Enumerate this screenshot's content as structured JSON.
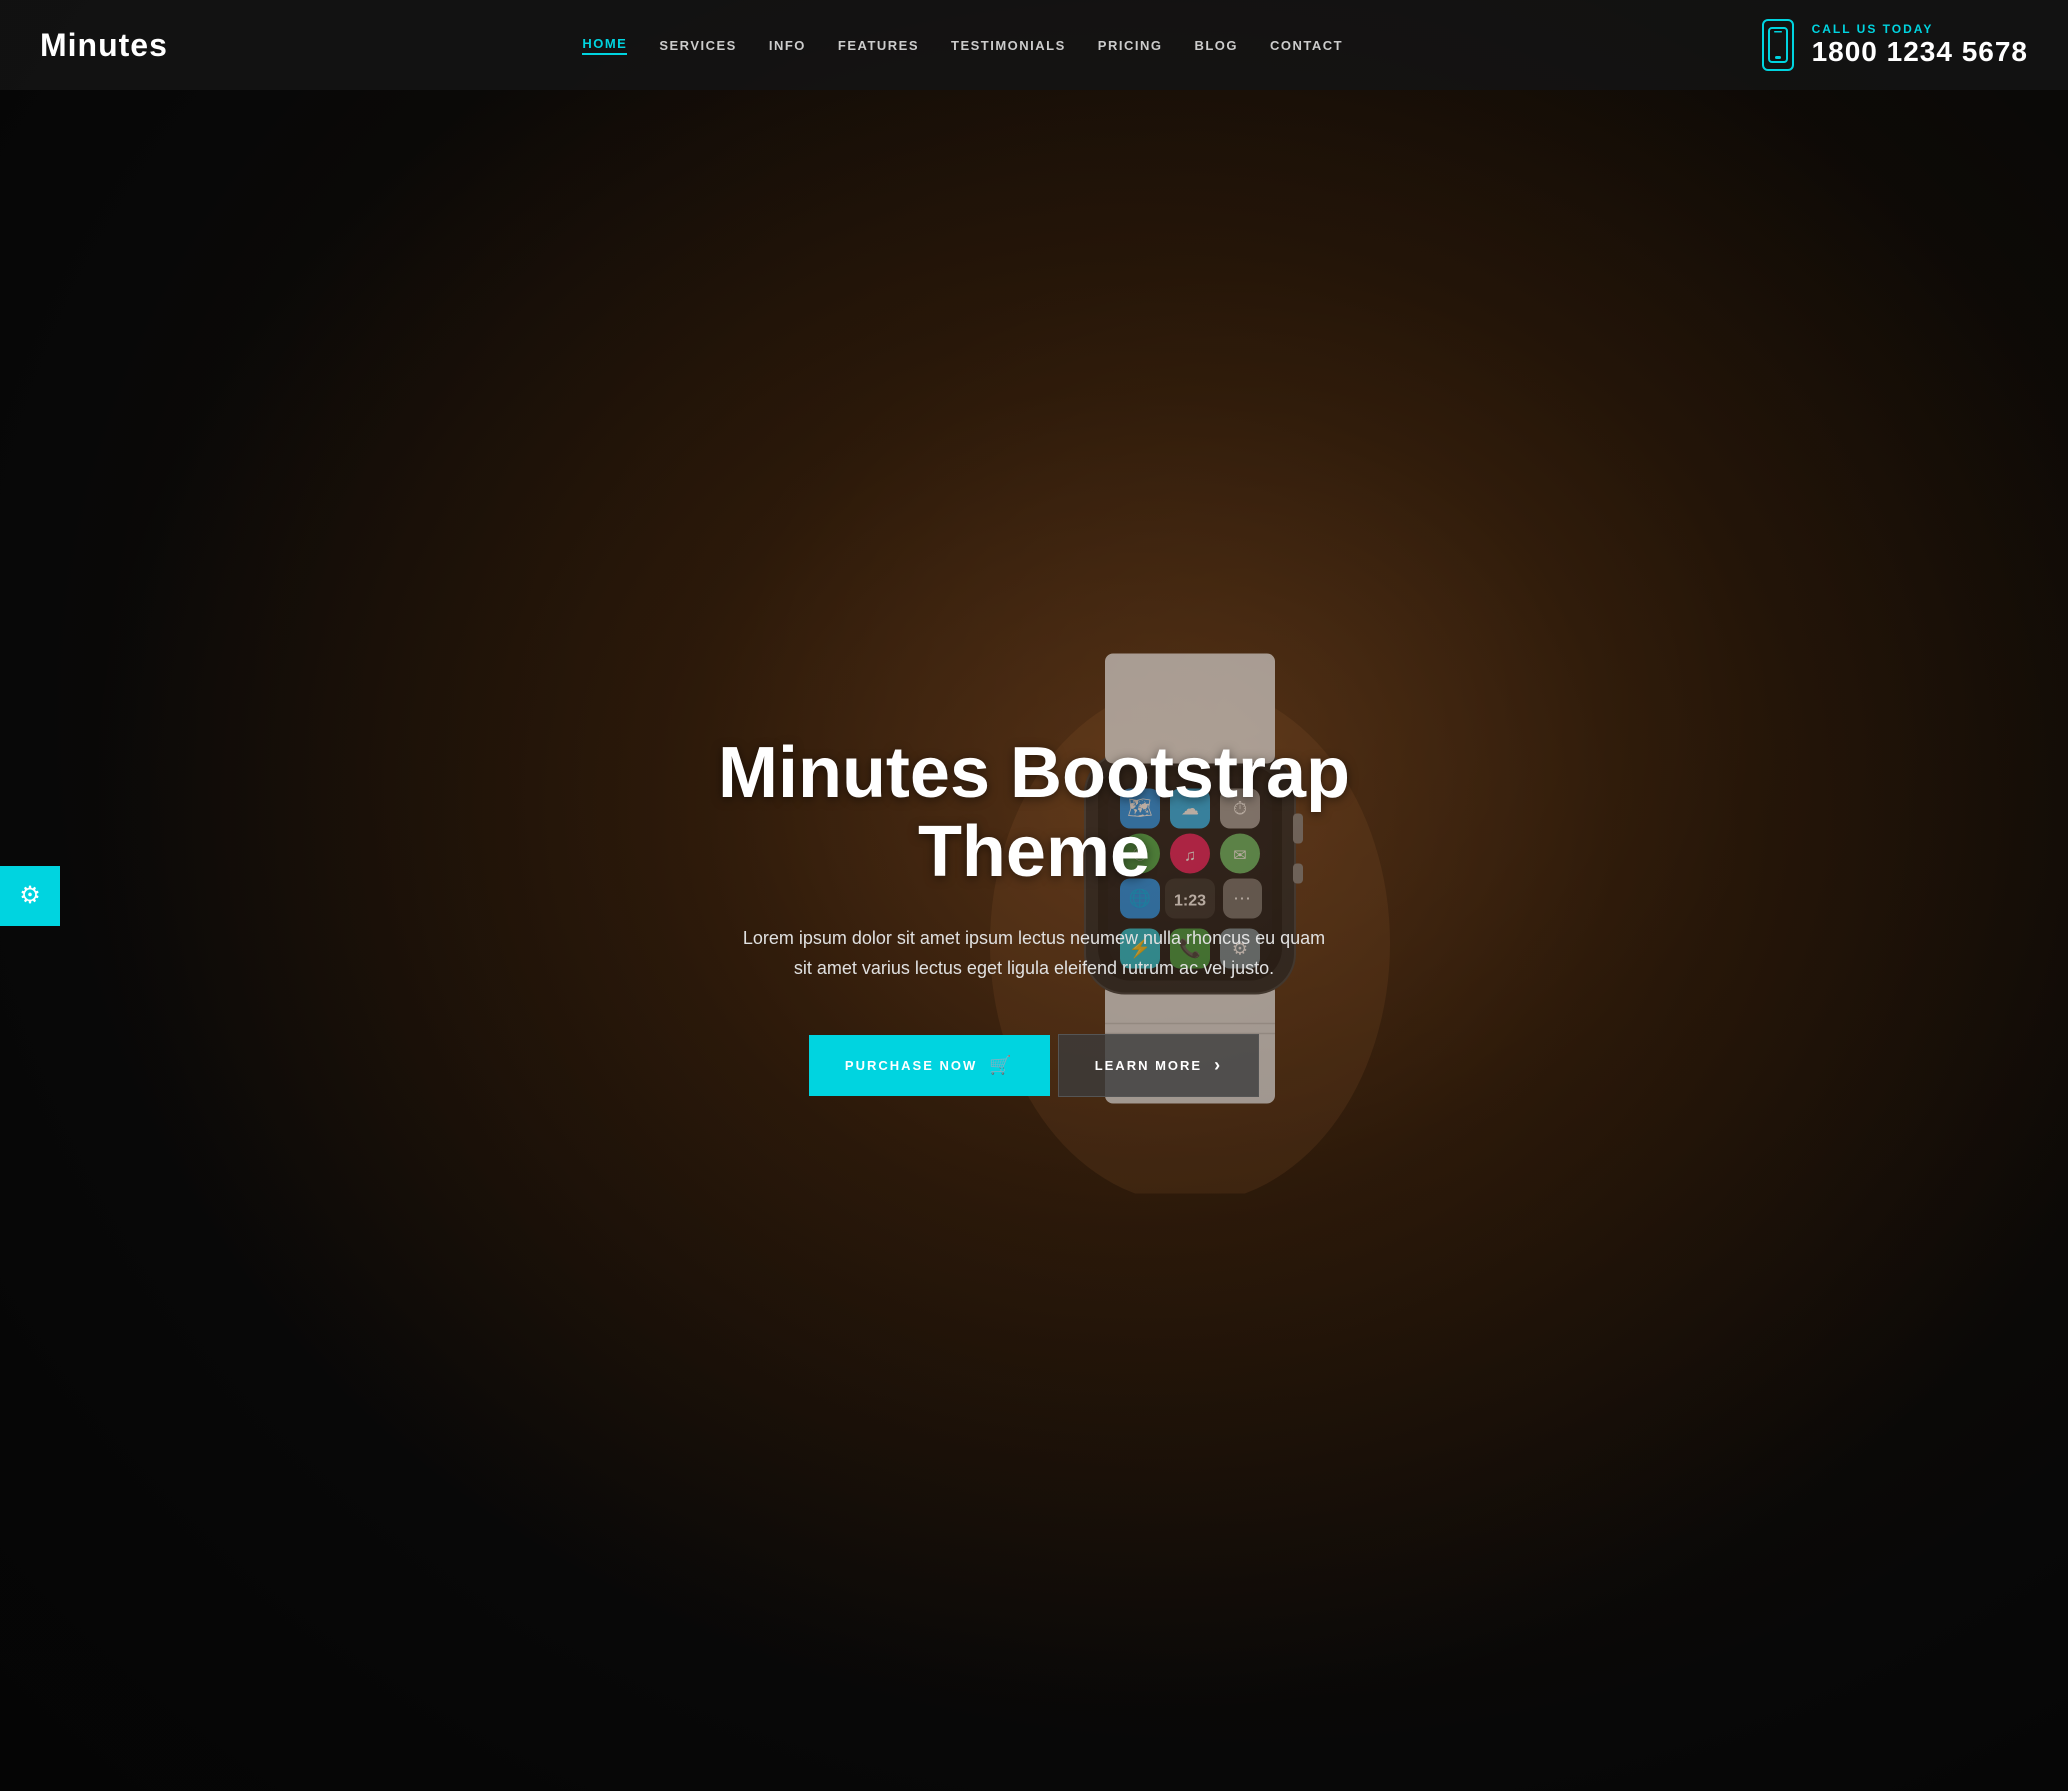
{
  "site": {
    "logo": "Minutes",
    "accent_color": "#00d4e0",
    "bg_color": "#111111"
  },
  "header": {
    "nav_items": [
      {
        "label": "HOME",
        "active": true
      },
      {
        "label": "SERVICES",
        "active": false
      },
      {
        "label": "INFO",
        "active": false
      },
      {
        "label": "FEATURES",
        "active": false
      },
      {
        "label": "TESTIMONIALS",
        "active": false
      },
      {
        "label": "PRICING",
        "active": false
      },
      {
        "label": "BLOG",
        "active": false
      },
      {
        "label": "CONTACT",
        "active": false
      }
    ],
    "call_label": "CALL US TODAY",
    "phone": "1800 1234 5678"
  },
  "hero": {
    "title": "Minutes Bootstrap Theme",
    "description": "Lorem ipsum dolor sit amet ipsum lectus neumew nulla rhoncus eu quam sit amet varius lectus eget ligula eleifend rutrum ac vel justo.",
    "btn_purchase_label": "PURCHASE NOW",
    "btn_learn_label": "LEARN MORE"
  },
  "settings": {
    "icon": "⚙"
  }
}
